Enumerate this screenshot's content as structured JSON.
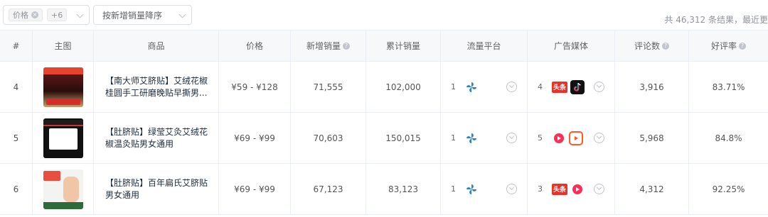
{
  "filter": {
    "tag_label": "价格",
    "more_label": "+6",
    "sort_label": "按新增销量降序"
  },
  "result_text": "共 46,312 条结果，最近更",
  "headers": {
    "index": "#",
    "image": "主图",
    "product": "商品",
    "price": "价格",
    "new_sales": "新增销量",
    "total_sales": "累计销量",
    "platform": "流量平台",
    "media": "广告媒体",
    "comments": "评论数",
    "rating": "好评率"
  },
  "rows": [
    {
      "index": "4",
      "name": "【南大师艾脐贴】艾绒花椒桂圆手工研磨晚贴早撕男...",
      "price": "¥59 - ¥128",
      "new_sales": "71,555",
      "total_sales": "102,000",
      "platform_count": "1",
      "media_count": "4",
      "media_icons": [
        "toutiao-icon",
        "douyin-icon"
      ],
      "comments": "3,916",
      "rating": "83.71%"
    },
    {
      "index": "5",
      "name": "【肚脐贴】绿莹艾灸艾绒花椒温灸贴男女通用",
      "price": "¥69 - ¥99",
      "new_sales": "70,603",
      "total_sales": "150,015",
      "platform_count": "1",
      "media_count": "5",
      "media_icons": [
        "huoshan-icon",
        "kuaishou-icon"
      ],
      "comments": "5,968",
      "rating": "84.8%"
    },
    {
      "index": "6",
      "name": "【肚脐贴】百年扁氏艾脐贴男女通用",
      "price": "¥69 - ¥99",
      "new_sales": "67,123",
      "total_sales": "83,123",
      "platform_count": "1",
      "media_count": "3",
      "media_icons": [
        "toutiao-icon",
        "huoshan-icon"
      ],
      "comments": "4,312",
      "rating": "92.25%"
    }
  ],
  "media_labels": {
    "toutiao": "头条"
  },
  "colors": {
    "accent_red": "#e8322a",
    "kuaishou_orange": "#ff5a22",
    "huoshan_red": "#ff2c55",
    "pinwheel_blue": "#2f80c9"
  }
}
